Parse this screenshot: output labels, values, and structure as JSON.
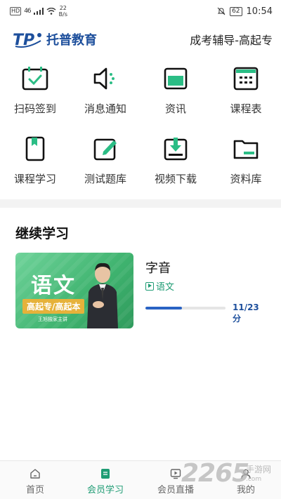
{
  "status_bar": {
    "hd": "HD",
    "signal": "46",
    "speed_value": "22",
    "speed_unit": "B/s",
    "battery": "62",
    "time": "10:54"
  },
  "header": {
    "brand_name": "托普教育",
    "title": "成考辅导-高起专"
  },
  "grid": [
    {
      "label": "扫码签到",
      "icon": "calendar-check-icon"
    },
    {
      "label": "消息通知",
      "icon": "speaker-icon"
    },
    {
      "label": "资讯",
      "icon": "folder-news-icon"
    },
    {
      "label": "课程表",
      "icon": "schedule-icon"
    },
    {
      "label": "课程学习",
      "icon": "bookmark-icon"
    },
    {
      "label": "测试题库",
      "icon": "edit-icon"
    },
    {
      "label": "视频下载",
      "icon": "download-icon"
    },
    {
      "label": "资料库",
      "icon": "folder-icon"
    }
  ],
  "continue": {
    "title": "继续学习",
    "course": {
      "thumb_subject": "语文",
      "thumb_tag": "高起专/高起本",
      "thumb_teacher": "王旭独家主讲",
      "name": "字音",
      "subject": "语文",
      "progress_fraction": 0.46,
      "progress_text": "11/23分"
    }
  },
  "bottom_nav": [
    {
      "label": "首页",
      "icon": "home-icon"
    },
    {
      "label": "会员学习",
      "icon": "document-icon"
    },
    {
      "label": "会员直播",
      "icon": "live-icon"
    },
    {
      "label": "我的",
      "icon": "profile-icon"
    }
  ],
  "watermark": {
    "number": "2265",
    "text": "手游网",
    "url": ".com"
  },
  "colors": {
    "accent": "#1f9c74",
    "brand": "#1d4f9c",
    "progress": "#2a63c4"
  }
}
